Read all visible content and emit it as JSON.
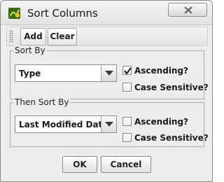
{
  "window": {
    "title": "Sort Columns",
    "app_icon": "java-app-icon",
    "close_icon": "close-icon"
  },
  "toolbar": {
    "add_label": "Add",
    "clear_label": "Clear"
  },
  "sort_by": {
    "legend": "Sort By",
    "selected": "Type",
    "ascending_label": "Ascending?",
    "ascending_checked": true,
    "case_sensitive_label": "Case Sensitive?",
    "case_sensitive_checked": false
  },
  "then_sort_by": {
    "legend": "Then Sort By",
    "selected": "Last Modified Date",
    "ascending_label": "Ascending?",
    "ascending_checked": false,
    "case_sensitive_label": "Case Sensitive?",
    "case_sensitive_checked": false
  },
  "buttons": {
    "ok_label": "OK",
    "cancel_label": "Cancel"
  }
}
